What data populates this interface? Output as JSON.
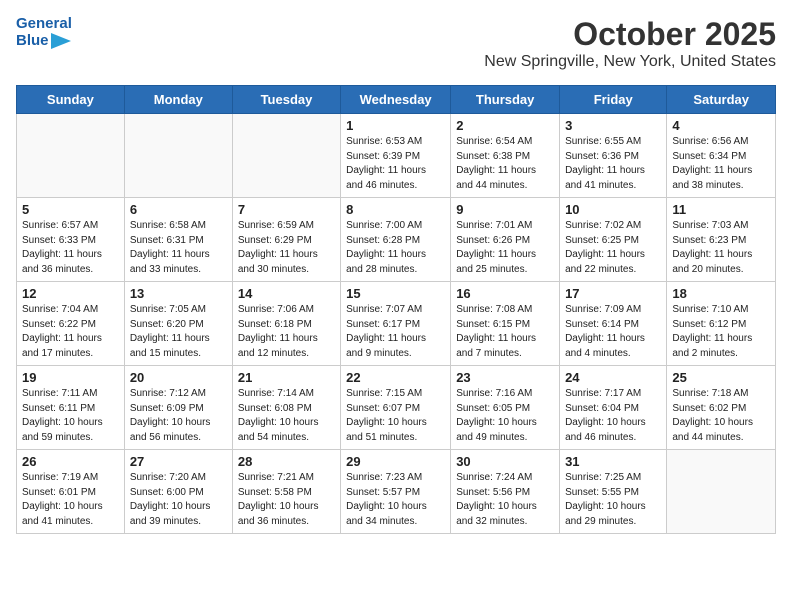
{
  "logo": {
    "general": "General",
    "blue": "Blue"
  },
  "title": "October 2025",
  "subtitle": "New Springville, New York, United States",
  "headers": [
    "Sunday",
    "Monday",
    "Tuesday",
    "Wednesday",
    "Thursday",
    "Friday",
    "Saturday"
  ],
  "weeks": [
    [
      {
        "day": "",
        "info": ""
      },
      {
        "day": "",
        "info": ""
      },
      {
        "day": "",
        "info": ""
      },
      {
        "day": "1",
        "info": "Sunrise: 6:53 AM\nSunset: 6:39 PM\nDaylight: 11 hours and 46 minutes."
      },
      {
        "day": "2",
        "info": "Sunrise: 6:54 AM\nSunset: 6:38 PM\nDaylight: 11 hours and 44 minutes."
      },
      {
        "day": "3",
        "info": "Sunrise: 6:55 AM\nSunset: 6:36 PM\nDaylight: 11 hours and 41 minutes."
      },
      {
        "day": "4",
        "info": "Sunrise: 6:56 AM\nSunset: 6:34 PM\nDaylight: 11 hours and 38 minutes."
      }
    ],
    [
      {
        "day": "5",
        "info": "Sunrise: 6:57 AM\nSunset: 6:33 PM\nDaylight: 11 hours and 36 minutes."
      },
      {
        "day": "6",
        "info": "Sunrise: 6:58 AM\nSunset: 6:31 PM\nDaylight: 11 hours and 33 minutes."
      },
      {
        "day": "7",
        "info": "Sunrise: 6:59 AM\nSunset: 6:29 PM\nDaylight: 11 hours and 30 minutes."
      },
      {
        "day": "8",
        "info": "Sunrise: 7:00 AM\nSunset: 6:28 PM\nDaylight: 11 hours and 28 minutes."
      },
      {
        "day": "9",
        "info": "Sunrise: 7:01 AM\nSunset: 6:26 PM\nDaylight: 11 hours and 25 minutes."
      },
      {
        "day": "10",
        "info": "Sunrise: 7:02 AM\nSunset: 6:25 PM\nDaylight: 11 hours and 22 minutes."
      },
      {
        "day": "11",
        "info": "Sunrise: 7:03 AM\nSunset: 6:23 PM\nDaylight: 11 hours and 20 minutes."
      }
    ],
    [
      {
        "day": "12",
        "info": "Sunrise: 7:04 AM\nSunset: 6:22 PM\nDaylight: 11 hours and 17 minutes."
      },
      {
        "day": "13",
        "info": "Sunrise: 7:05 AM\nSunset: 6:20 PM\nDaylight: 11 hours and 15 minutes."
      },
      {
        "day": "14",
        "info": "Sunrise: 7:06 AM\nSunset: 6:18 PM\nDaylight: 11 hours and 12 minutes."
      },
      {
        "day": "15",
        "info": "Sunrise: 7:07 AM\nSunset: 6:17 PM\nDaylight: 11 hours and 9 minutes."
      },
      {
        "day": "16",
        "info": "Sunrise: 7:08 AM\nSunset: 6:15 PM\nDaylight: 11 hours and 7 minutes."
      },
      {
        "day": "17",
        "info": "Sunrise: 7:09 AM\nSunset: 6:14 PM\nDaylight: 11 hours and 4 minutes."
      },
      {
        "day": "18",
        "info": "Sunrise: 7:10 AM\nSunset: 6:12 PM\nDaylight: 11 hours and 2 minutes."
      }
    ],
    [
      {
        "day": "19",
        "info": "Sunrise: 7:11 AM\nSunset: 6:11 PM\nDaylight: 10 hours and 59 minutes."
      },
      {
        "day": "20",
        "info": "Sunrise: 7:12 AM\nSunset: 6:09 PM\nDaylight: 10 hours and 56 minutes."
      },
      {
        "day": "21",
        "info": "Sunrise: 7:14 AM\nSunset: 6:08 PM\nDaylight: 10 hours and 54 minutes."
      },
      {
        "day": "22",
        "info": "Sunrise: 7:15 AM\nSunset: 6:07 PM\nDaylight: 10 hours and 51 minutes."
      },
      {
        "day": "23",
        "info": "Sunrise: 7:16 AM\nSunset: 6:05 PM\nDaylight: 10 hours and 49 minutes."
      },
      {
        "day": "24",
        "info": "Sunrise: 7:17 AM\nSunset: 6:04 PM\nDaylight: 10 hours and 46 minutes."
      },
      {
        "day": "25",
        "info": "Sunrise: 7:18 AM\nSunset: 6:02 PM\nDaylight: 10 hours and 44 minutes."
      }
    ],
    [
      {
        "day": "26",
        "info": "Sunrise: 7:19 AM\nSunset: 6:01 PM\nDaylight: 10 hours and 41 minutes."
      },
      {
        "day": "27",
        "info": "Sunrise: 7:20 AM\nSunset: 6:00 PM\nDaylight: 10 hours and 39 minutes."
      },
      {
        "day": "28",
        "info": "Sunrise: 7:21 AM\nSunset: 5:58 PM\nDaylight: 10 hours and 36 minutes."
      },
      {
        "day": "29",
        "info": "Sunrise: 7:23 AM\nSunset: 5:57 PM\nDaylight: 10 hours and 34 minutes."
      },
      {
        "day": "30",
        "info": "Sunrise: 7:24 AM\nSunset: 5:56 PM\nDaylight: 10 hours and 32 minutes."
      },
      {
        "day": "31",
        "info": "Sunrise: 7:25 AM\nSunset: 5:55 PM\nDaylight: 10 hours and 29 minutes."
      },
      {
        "day": "",
        "info": ""
      }
    ]
  ]
}
